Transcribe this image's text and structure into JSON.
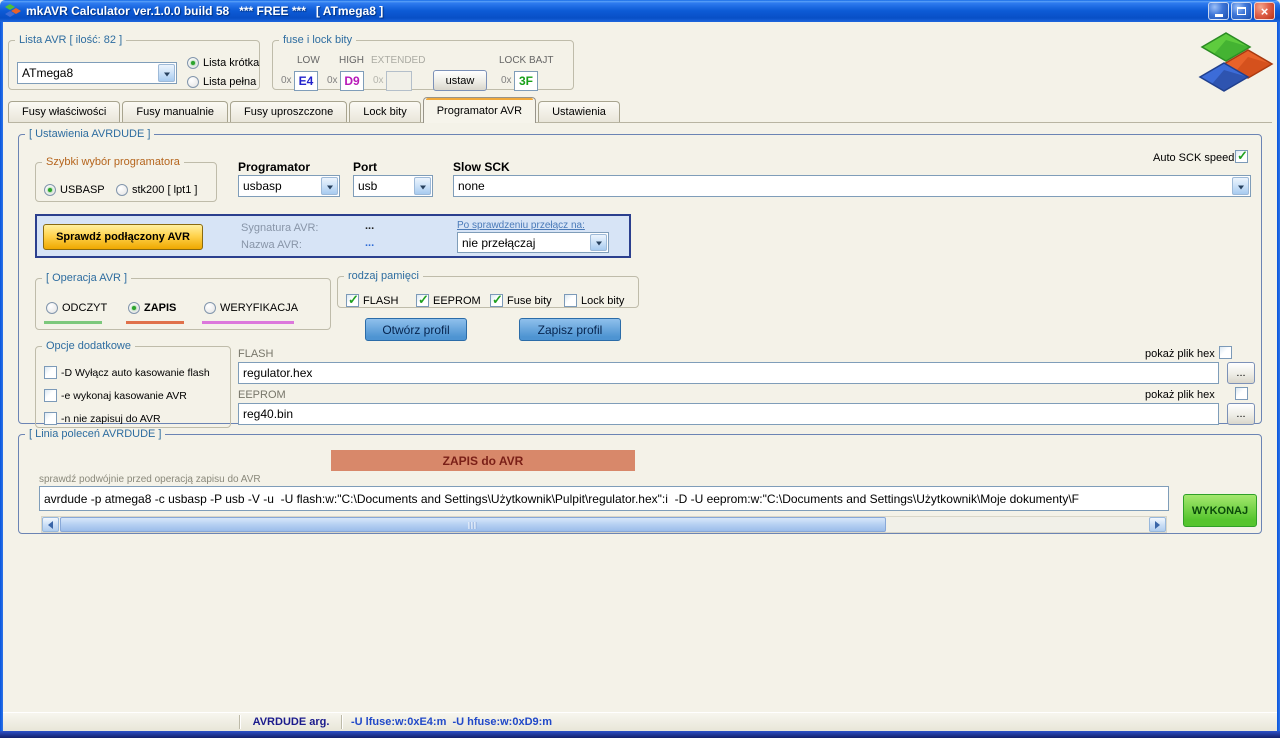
{
  "window": {
    "title": "mkAVR Calculator ver.1.0.0 build 58   *** FREE ***   [ ATmega8 ]"
  },
  "avr_list": {
    "legend": "Lista AVR [ ilość: 82 ]",
    "selected": "ATmega8",
    "short_label": "Lista krótka",
    "full_label": "Lista pełna"
  },
  "fuse_lock": {
    "legend": "fuse i lock bity",
    "low_label": "LOW",
    "high_label": "HIGH",
    "extended_label": "EXTENDED",
    "hex_prefix": "0x",
    "low_value": "E4",
    "high_value": "D9",
    "extended_value": "",
    "set_button": "ustaw",
    "lock_label": "LOCK BAJT",
    "lock_value": "3F"
  },
  "tabs": [
    "Fusy właściwości",
    "Fusy manualnie",
    "Fusy uproszczone",
    "Lock bity",
    "Programator AVR",
    "Ustawienia"
  ],
  "settings": {
    "legend": "[ Ustawienia AVRDUDE ]",
    "quick": {
      "legend": "Szybki wybór programatora",
      "usbasp": "USBASP",
      "stk200": "stk200 [ lpt1 ]"
    },
    "programator_label": "Programator",
    "programator_value": "usbasp",
    "port_label": "Port",
    "port_value": "usb",
    "slow_sck_label": "Slow SCK",
    "slow_sck_value": "none",
    "auto_sck_label": "Auto SCK speed",
    "check": {
      "button": "Sprawdź podłączony AVR",
      "signature_label": "Sygnatura AVR:",
      "signature_value": "...",
      "name_label": "Nazwa AVR:",
      "name_value": "...",
      "switch_label": "Po sprawdzeniu przełącz na:",
      "switch_value": "nie przełączaj"
    },
    "operation": {
      "legend": "[ Operacja AVR ]",
      "read": "ODCZYT",
      "write": "ZAPIS",
      "verify": "WERYFIKACJA"
    },
    "memory": {
      "legend": "rodzaj pamięci",
      "flash": "FLASH",
      "eeprom": "EEPROM",
      "fuse": "Fuse bity",
      "lock": "Lock bity"
    },
    "open_profile": "Otwórz profil",
    "save_profile": "Zapisz profil",
    "extra": {
      "legend": "Opcje dodatkowe",
      "opt_d": "-D Wyłącz auto kasowanie flash",
      "opt_e": "-e wykonaj kasowanie AVR",
      "opt_n": "-n nie zapisuj do AVR"
    },
    "flash_label": "FLASH",
    "flash_file": "regulator.hex",
    "eeprom_label": "EEPROM",
    "eeprom_file": "reg40.bin",
    "show_hex_label": "pokaż plik hex",
    "browse_label": "..."
  },
  "cmdline": {
    "legend": "[ Linia poleceń AVRDUDE ]",
    "banner": "ZAPIS do AVR",
    "hint": "sprawdź podwójnie przed operacją zapisu do AVR",
    "command": "avrdude -p atmega8 -c usbasp -P usb -V -u  -U flash:w:\"C:\\Documents and Settings\\Użytkownik\\Pulpit\\regulator.hex\":i  -D -U eeprom:w:\"C:\\Documents and Settings\\Użytkownik\\Moje dokumenty\\F",
    "execute": "WYKONAJ"
  },
  "statusbar": {
    "label": "AVRDUDE arg.",
    "value": "-U lfuse:w:0xE4:m  -U hfuse:w:0xD9:m"
  }
}
